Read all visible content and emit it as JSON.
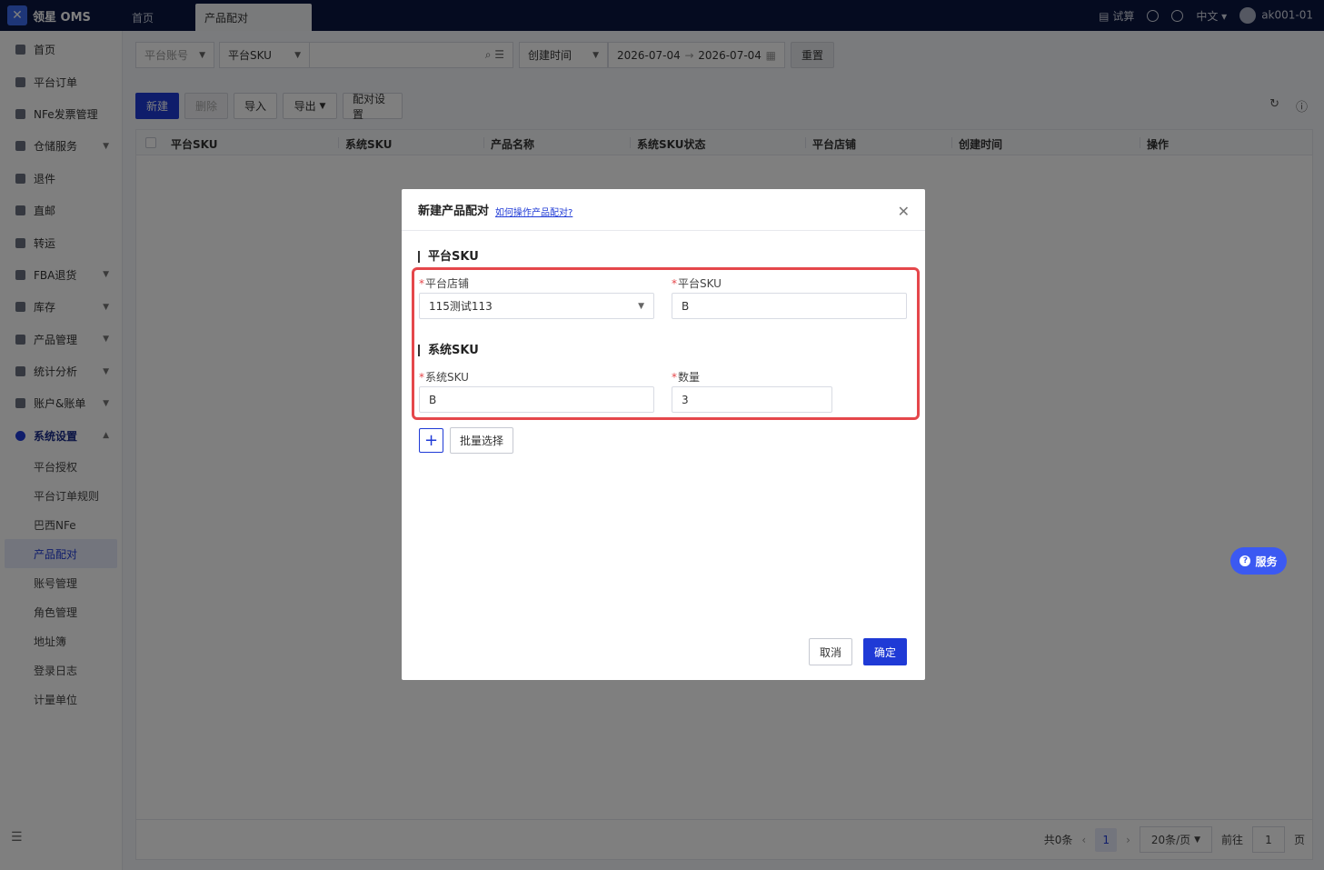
{
  "app": {
    "logo_text": "领星 OMS"
  },
  "tabs": [
    {
      "label": "首页"
    },
    {
      "label": "产品配对"
    }
  ],
  "topbar": {
    "trial_label": "试算",
    "language": "中文",
    "username": "ak001-01"
  },
  "sidebar": {
    "items": [
      {
        "label": "首页"
      },
      {
        "label": "平台订单"
      },
      {
        "label": "NFe发票管理"
      },
      {
        "label": "仓储服务"
      },
      {
        "label": "退件"
      },
      {
        "label": "直邮"
      },
      {
        "label": "转运"
      },
      {
        "label": "FBA退货"
      },
      {
        "label": "库存"
      },
      {
        "label": "产品管理"
      },
      {
        "label": "统计分析"
      },
      {
        "label": "账户&账单"
      },
      {
        "label": "系统设置"
      }
    ],
    "sub_items": [
      {
        "label": "平台授权"
      },
      {
        "label": "平台订单规则"
      },
      {
        "label": "巴西NFe"
      },
      {
        "label": "产品配对"
      },
      {
        "label": "账号管理"
      },
      {
        "label": "角色管理"
      },
      {
        "label": "地址簿"
      },
      {
        "label": "登录日志"
      },
      {
        "label": "计量单位"
      }
    ]
  },
  "filters": {
    "platform_account_placeholder": "平台账号",
    "sku_type": "平台SKU",
    "search_value": "",
    "time_type": "创建时间",
    "date_start": "2026-07-04",
    "date_end": "2026-07-04",
    "reset_label": "重置"
  },
  "toolbar": {
    "new_label": "新建",
    "delete_label": "删除",
    "import_label": "导入",
    "export_label": "导出",
    "config_label": "配对设置"
  },
  "table": {
    "columns": [
      "平台SKU",
      "系统SKU",
      "产品名称",
      "系统SKU状态",
      "平台店铺",
      "创建时间",
      "操作"
    ]
  },
  "pager": {
    "total": "共0条",
    "page": "1",
    "page_size": "20条/页",
    "goto_label": "前往",
    "goto_value": "1",
    "page_suffix": "页"
  },
  "modal": {
    "title": "新建产品配对",
    "help_link": "如何操作产品配对?",
    "section_platform": "平台SKU",
    "store_label": "平台店铺",
    "store_value": "115测试113",
    "platform_sku_label": "平台SKU",
    "platform_sku_value": "B",
    "section_system": "系统SKU",
    "system_sku_label": "系统SKU",
    "system_sku_value": "B",
    "qty_label": "数量",
    "qty_value": "3",
    "batch_label": "批量选择",
    "cancel_label": "取消",
    "ok_label": "确定"
  },
  "service_button": {
    "label": "服务"
  }
}
